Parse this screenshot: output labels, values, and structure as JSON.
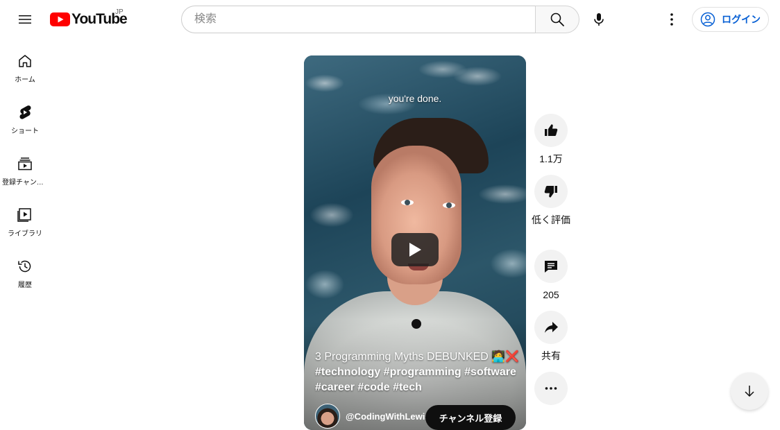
{
  "header": {
    "logo_text": "YouTube",
    "region": "JP",
    "search_placeholder": "検索",
    "login_label": "ログイン"
  },
  "sidebar": {
    "items": [
      {
        "label": "ホーム",
        "icon": "home-icon"
      },
      {
        "label": "ショート",
        "icon": "shorts-icon"
      },
      {
        "label": "登録チャンネル",
        "icon": "subscriptions-icon"
      },
      {
        "label": "ライブラリ",
        "icon": "library-icon"
      },
      {
        "label": "履歴",
        "icon": "history-icon"
      }
    ]
  },
  "video": {
    "caption": "you're done.",
    "title_main": "3 Programming Myths DEBUNKED 🧑‍💻❌",
    "title_tags": "#technology #programming #software #career #code #tech",
    "channel": "@CodingWithLewis",
    "subscribe_label": "チャンネル登録"
  },
  "actions": {
    "like_count": "1.1万",
    "dislike_label": "低く評価",
    "comment_count": "205",
    "share_label": "共有"
  },
  "colors": {
    "brand_red": "#ff0000",
    "link_blue": "#065fd4"
  }
}
